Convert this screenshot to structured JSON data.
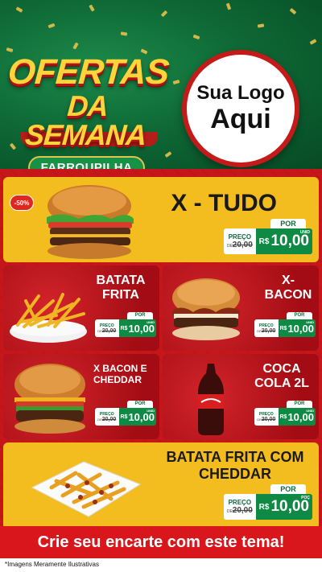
{
  "header": {
    "title_line1": "OFERTAS",
    "title_line2": "DA SEMANA",
    "city": "FARROUPILHA",
    "logo_line1": "Sua Logo",
    "logo_line2": "Aqui"
  },
  "colors": {
    "green_bg": "#0f6a36",
    "red_bg": "#c7161a",
    "yellow_card": "#f4bd1f",
    "price_green": "#0e8a45",
    "title_yellow": "#ffd43a"
  },
  "products": [
    {
      "id": "x-tudo",
      "name": "X - TUDO",
      "badge": "-50%",
      "image_icon": "burger-icon",
      "por_label": "POR",
      "preco_label": "PREÇO",
      "de_label": "DE",
      "old_price": "20,00",
      "currency": "R$",
      "new_price": "10,00",
      "unit": "UNID"
    },
    {
      "id": "batata-frita",
      "name": "BATATA FRITA",
      "image_icon": "fries-icon",
      "por_label": "POR",
      "preco_label": "PREÇO",
      "de_label": "DE",
      "old_price": "20,00",
      "currency": "R$",
      "new_price": "10,00",
      "unit": "UNID"
    },
    {
      "id": "x-bacon",
      "name": "X-BACON",
      "image_icon": "burger-icon",
      "por_label": "POR",
      "preco_label": "PREÇO",
      "de_label": "DE",
      "old_price": "20,00",
      "currency": "R$",
      "new_price": "10,00",
      "unit": "UNID"
    },
    {
      "id": "x-bacon-cheddar",
      "name": "X BACON E CHEDDAR",
      "image_icon": "burger-icon",
      "por_label": "POR",
      "preco_label": "PREÇO",
      "de_label": "DE",
      "old_price": "20,00",
      "currency": "R$",
      "new_price": "10,00",
      "unit": "UNID"
    },
    {
      "id": "coca-cola",
      "name": "COCA COLA 2L",
      "image_icon": "soda-bottle-icon",
      "por_label": "POR",
      "preco_label": "PREÇO",
      "de_label": "DE",
      "old_price": "20,00",
      "currency": "R$",
      "new_price": "10,00",
      "unit": "UNID"
    },
    {
      "id": "batata-cheddar",
      "name": "BATATA FRITA COM CHEDDAR",
      "image_icon": "fries-cheddar-icon",
      "por_label": "POR",
      "preco_label": "PREÇO",
      "de_label": "DE",
      "old_price": "20,00",
      "currency": "R$",
      "new_price": "10,00",
      "unit": "POÇ"
    }
  ],
  "footer": {
    "cta": "Crie seu encarte com este tema!",
    "disclaimer": "*Imagens Meramente Ilustrativas"
  }
}
